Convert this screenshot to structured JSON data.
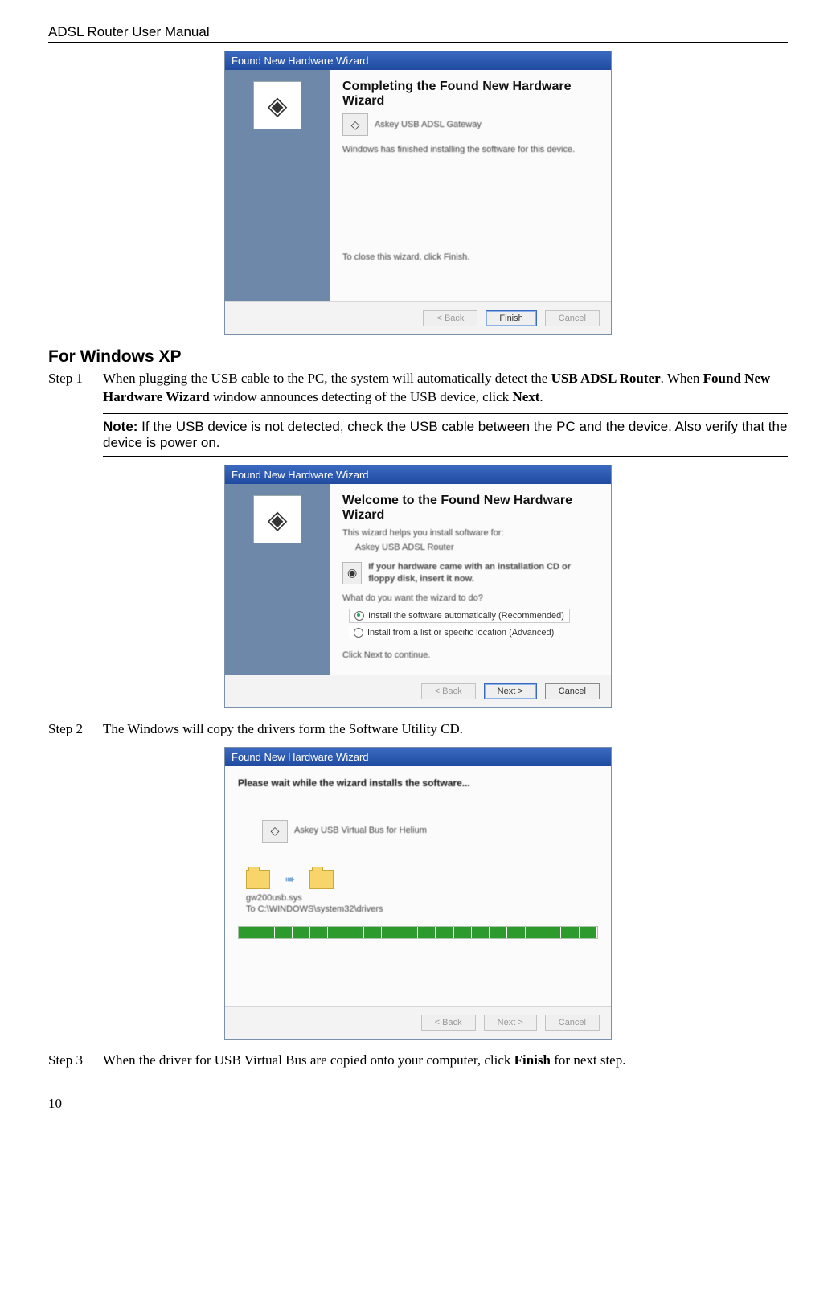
{
  "header": {
    "title": "ADSL Router User Manual"
  },
  "section": {
    "title": "For Windows XP"
  },
  "steps": {
    "s1": {
      "label": "Step 1",
      "text_a": "When plugging the USB cable to the PC, the system will automatically detect the ",
      "bold_a": "USB ADSL Router",
      "text_b": ". When ",
      "bold_b": "Found New Hardware Wizard",
      "text_c": " window announces detecting of the USB device, click ",
      "bold_c": "Next",
      "text_d": "."
    },
    "s2": {
      "label": "Step 2",
      "text": "The Windows will copy the drivers form the Software Utility CD."
    },
    "s3": {
      "label": "Step 3",
      "text_a": "When the driver for USB Virtual Bus are copied onto your computer, click ",
      "bold_a": "Finish",
      "text_b": " for next step."
    }
  },
  "note": {
    "label": "Note:",
    "text": " If the USB device is not detected, check the USB cable between the PC and the device. Also verify that the device is power on."
  },
  "shots": {
    "a": {
      "title": "Found New Hardware Wizard",
      "heading": "Completing the Found New Hardware Wizard",
      "device": "Askey USB ADSL Gateway",
      "line1": "Windows has finished installing the software for this device.",
      "line2": "To close this wizard, click Finish.",
      "back": "< Back",
      "finish": "Finish",
      "cancel": "Cancel"
    },
    "b": {
      "title": "Found New Hardware Wizard",
      "heading": "Welcome to the Found New Hardware Wizard",
      "line1": "This wizard helps you install software for:",
      "device": "Askey USB ADSL Router",
      "info": "If your hardware came with an installation CD or floppy disk, insert it now.",
      "q": "What do you want the wizard to do?",
      "opt1": "Install the software automatically (Recommended)",
      "opt2": "Install from a list or specific location (Advanced)",
      "cont": "Click Next to continue.",
      "back": "< Back",
      "next": "Next >",
      "cancel": "Cancel"
    },
    "c": {
      "title": "Found New Hardware Wizard",
      "heading": "Please wait while the wizard installs the software...",
      "device": "Askey  USB Virtual Bus for Helium",
      "file": "gw200usb.sys",
      "dest": "To C:\\WINDOWS\\system32\\drivers",
      "back": "< Back",
      "next": "Next >",
      "cancel": "Cancel"
    }
  },
  "page": {
    "num": "10"
  }
}
